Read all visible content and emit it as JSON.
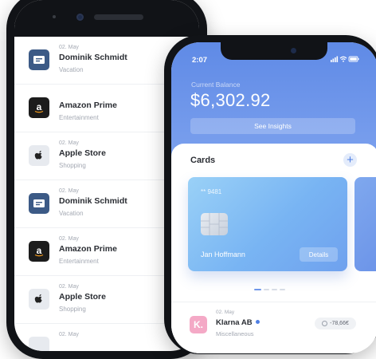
{
  "back_phone": {
    "transactions": [
      {
        "date": "02. May",
        "name": "Dominik Schmidt",
        "category": "Vacation",
        "icon": "ticket-icon"
      },
      {
        "date": "",
        "name": "Amazon Prime",
        "category": "Entertainment",
        "icon": "amazon-icon"
      },
      {
        "date": "02. May",
        "name": "Apple Store",
        "category": "Shopping",
        "icon": "apple-icon"
      },
      {
        "date": "02. May",
        "name": "Dominik Schmidt",
        "category": "Vacation",
        "icon": "ticket-icon"
      },
      {
        "date": "02. May",
        "name": "Amazon Prime",
        "category": "Entertainment",
        "icon": "amazon-icon"
      },
      {
        "date": "02. May",
        "name": "Apple Store",
        "category": "Shopping",
        "icon": "apple-icon"
      },
      {
        "date": "02. May",
        "name": "",
        "category": "",
        "icon": "apple-icon"
      }
    ]
  },
  "front_phone": {
    "status": {
      "time": "2:07"
    },
    "balance": {
      "label": "Current Balance",
      "amount": "$6,302.92",
      "insights_label": "See Insights"
    },
    "cards_section": {
      "title": "Cards",
      "add_symbol": "+"
    },
    "card": {
      "number": "** 9481",
      "holder": "Jan Hoffmann",
      "details_label": "Details"
    },
    "transaction": {
      "icon_letter": "K.",
      "date": "02. May",
      "name": "Klarna AB",
      "category": "Miscellaneous",
      "amount": "-78,66€"
    }
  },
  "colors": {
    "accent": "#5f8ae6",
    "klarna": "#f4a9c6",
    "ticket": "#3c5a86"
  }
}
